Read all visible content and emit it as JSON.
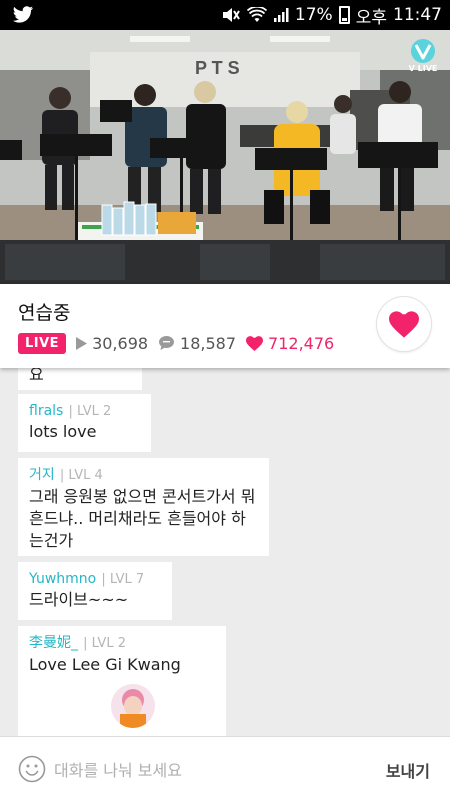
{
  "status_bar": {
    "battery": "17%",
    "period": "오후",
    "time": "11:47",
    "icons": [
      "twitter-icon",
      "mute-icon",
      "wifi-icon",
      "signal-icon",
      "battery-icon"
    ]
  },
  "video": {
    "logo_text": "V LIVE",
    "banner_text": "P T S"
  },
  "broadcast": {
    "title": "연습중",
    "live_label": "LIVE",
    "views": "30,698",
    "comments": "18,587",
    "hearts": "712,476"
  },
  "chat": {
    "messages": [
      {
        "user": "",
        "level": "",
        "text": "요"
      },
      {
        "user": "flrals",
        "level": "LVL 2",
        "text": "lots love"
      },
      {
        "user": "거지",
        "level": "LVL 4",
        "text": "그래 응원봉 없으면 콘서트가서 뭐흔드냐.. 머리채라도 흔들어야 하는건가"
      },
      {
        "user": "Yuwhmno",
        "level": "LVL 7",
        "text": "드라이브~~~"
      },
      {
        "user": "李曼妮_",
        "level": "LVL 2",
        "text": "Love Lee Gi Kwang"
      }
    ]
  },
  "input": {
    "placeholder": "대화를 나눠 보세요",
    "send_label": "보내기"
  },
  "colors": {
    "accent": "#f2236b",
    "username": "#26b7c6"
  }
}
